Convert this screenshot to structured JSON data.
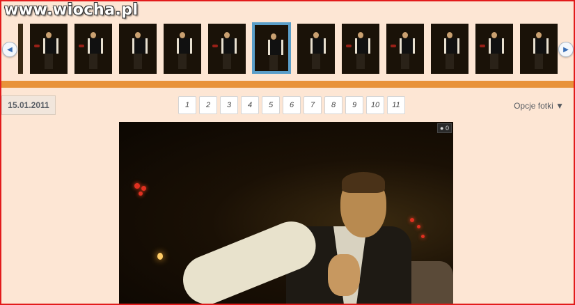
{
  "watermark": "www.wiocha.pl",
  "gallery": {
    "thumbnails_count": 13,
    "selected_index": 5
  },
  "toolbar": {
    "date": "15.01.2011",
    "pages": [
      "1",
      "2",
      "3",
      "4",
      "5",
      "6",
      "7",
      "8",
      "9",
      "10",
      "11"
    ],
    "options_label": "Opcje fotki ▼"
  },
  "photo": {
    "comment_count": "0"
  },
  "colors": {
    "background": "#fde6d4",
    "divider": "#e8923a",
    "selected_outline": "#5a9ec9",
    "frame": "#e21b1b"
  }
}
